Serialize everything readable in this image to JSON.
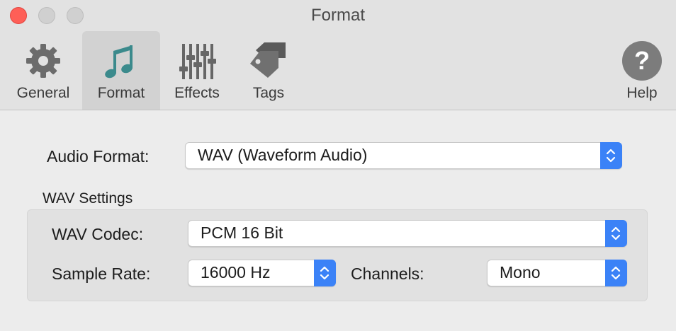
{
  "window": {
    "title": "Format"
  },
  "toolbar": {
    "general": "General",
    "format": "Format",
    "effects": "Effects",
    "tags": "Tags",
    "help": "Help",
    "active": "format"
  },
  "audio_format": {
    "label": "Audio Format:",
    "value": "WAV (Waveform Audio)"
  },
  "wav_settings": {
    "title": "WAV Settings",
    "codec_label": "WAV Codec:",
    "codec_value": "PCM 16 Bit",
    "sample_rate_label": "Sample Rate:",
    "sample_rate_value": "16000 Hz",
    "channels_label": "Channels:",
    "channels_value": "Mono"
  },
  "colors": {
    "accent": "#3b82f7",
    "close_button": "#fe5f57",
    "format_icon": "#3b8a8c",
    "toolbar_bg": "#e2e2e2",
    "content_bg": "#ececec"
  },
  "icons": {
    "general": "gear-icon",
    "format": "music-note-icon",
    "effects": "sliders-icon",
    "tags": "tag-icon",
    "help": "question-mark-icon",
    "stepper": "chevron-up-down-icon"
  }
}
